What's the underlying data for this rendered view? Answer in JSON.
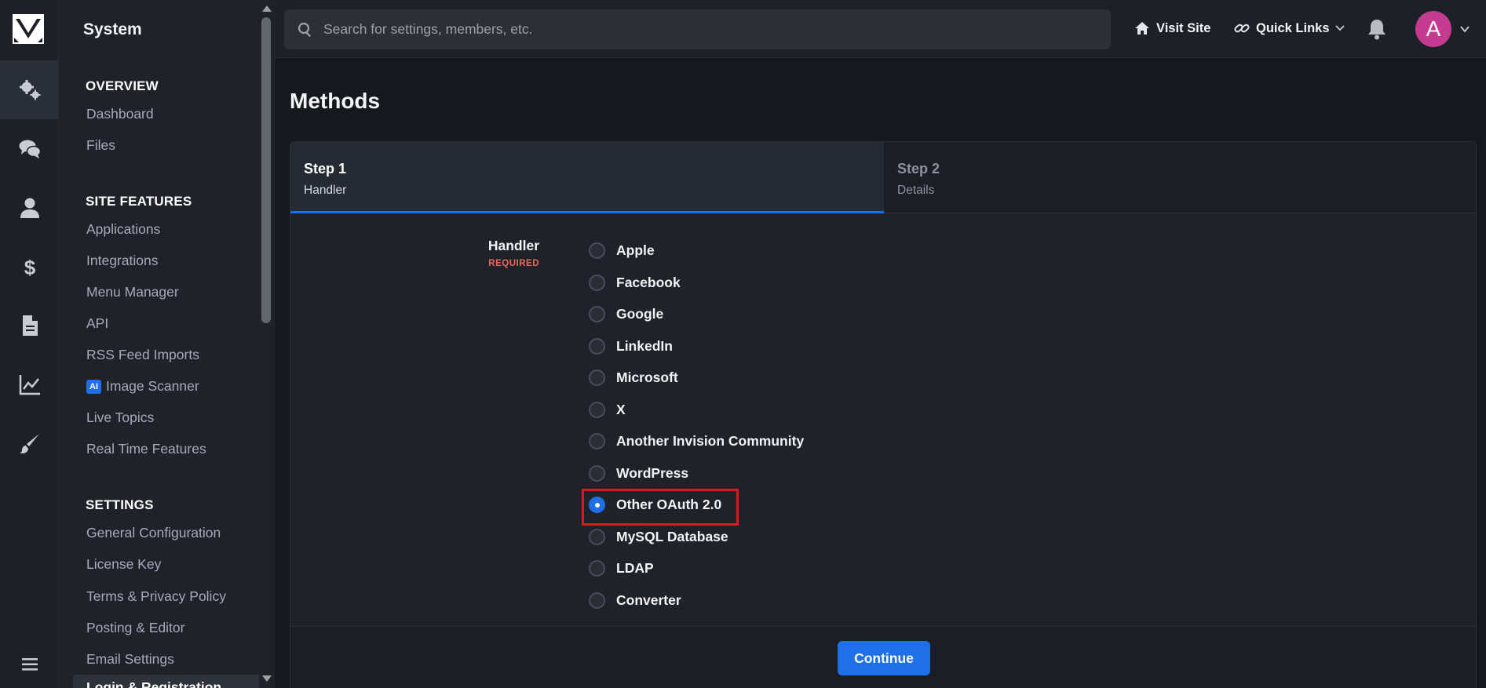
{
  "sidebar": {
    "title": "System",
    "sections": [
      {
        "heading": "OVERVIEW",
        "items": [
          "Dashboard",
          "Files"
        ]
      },
      {
        "heading": "SITE FEATURES",
        "items": [
          "Applications",
          "Integrations",
          "Menu Manager",
          "API",
          "RSS Feed Imports",
          "Image Scanner",
          "Live Topics",
          "Real Time Features"
        ]
      },
      {
        "heading": "SETTINGS",
        "items": [
          "General Configuration",
          "License Key",
          "Terms & Privacy Policy",
          "Posting & Editor",
          "Email Settings",
          "Login & Registration"
        ]
      }
    ],
    "ai_badge": "AI"
  },
  "topbar": {
    "search_placeholder": "Search for settings, members, etc.",
    "visit_site": "Visit Site",
    "quick_links": "Quick Links",
    "avatar_letter": "A"
  },
  "main": {
    "title": "Methods",
    "steps": [
      {
        "title": "Step 1",
        "subtitle": "Handler",
        "active": true
      },
      {
        "title": "Step 2",
        "subtitle": "Details",
        "active": false
      }
    ],
    "field": {
      "label": "Handler",
      "required": "REQUIRED"
    },
    "options": [
      "Apple",
      "Facebook",
      "Google",
      "LinkedIn",
      "Microsoft",
      "X",
      "Another Invision Community",
      "WordPress",
      "Other OAuth 2.0",
      "MySQL Database",
      "LDAP",
      "Converter"
    ],
    "selected_option": "Other OAuth 2.0",
    "continue_label": "Continue"
  },
  "colors": {
    "accent": "#1f6fe8",
    "highlight": "#d51b1b",
    "avatar": "#c53b8f",
    "required": "#ea6a5c"
  }
}
